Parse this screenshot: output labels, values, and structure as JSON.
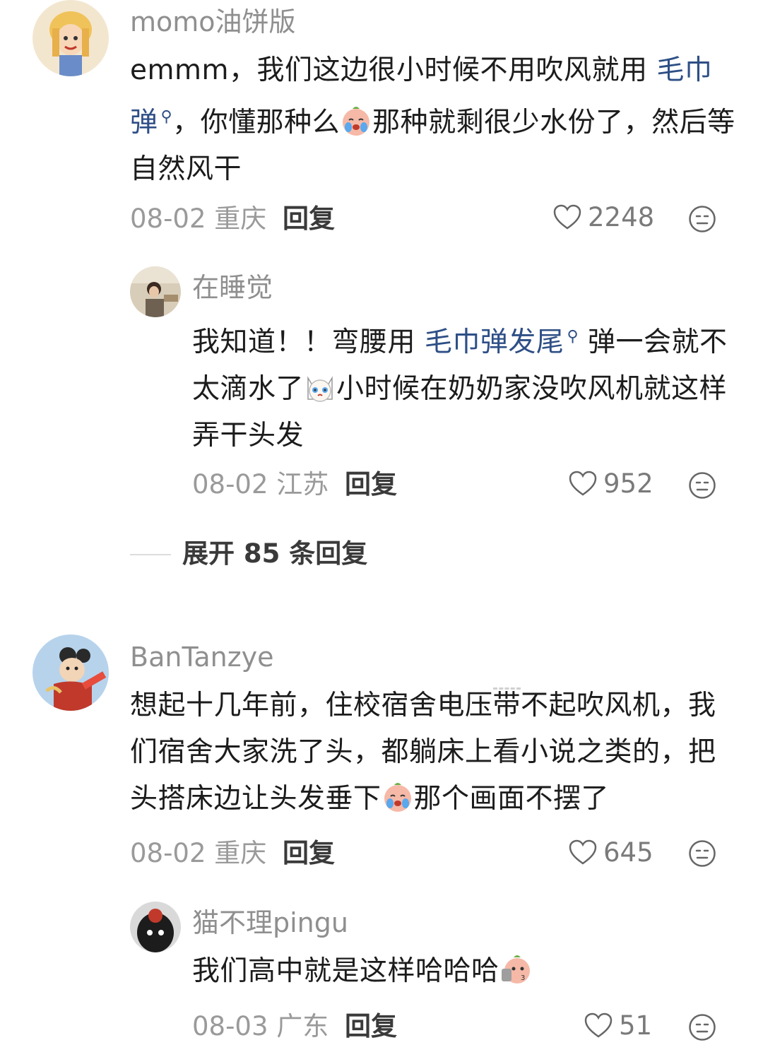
{
  "comments": [
    {
      "username": "momo油饼版",
      "text_1": "emmm，我们这边很小时候不用吹风就用",
      "link_1": "毛巾弹",
      "text_2": "，你懂那种么",
      "text_3": "那种就剩很少水份了，然后等自然风干",
      "date": "08-02",
      "location": "重庆",
      "reply_label": "回复",
      "likes": "2248"
    },
    {
      "username": "在睡觉",
      "text_1": "我知道！！弯腰用",
      "link_1": "毛巾弹发尾",
      "text_2": "弹一会就不太滴水了",
      "text_3": "小时候在奶奶家没吹风机就这样弄干头发",
      "date": "08-02",
      "location": "江苏",
      "reply_label": "回复",
      "likes": "952"
    },
    {
      "username": "BanTanzye",
      "text_1": "想起十几年前，住校宿舍电压",
      "text_mark": "带",
      "text_2": "不起吹风机，我们宿舍大家洗了头，都躺床上看小说之类的，把头搭床边让头发垂下",
      "text_3": "那个画面不摆了",
      "date": "08-02",
      "location": "重庆",
      "reply_label": "回复",
      "likes": "645"
    },
    {
      "username": "猫不理pingu",
      "text_1": "我们高中就是这样哈哈哈",
      "date": "08-03",
      "location": "广东",
      "reply_label": "回复",
      "likes": "51"
    }
  ],
  "expand_replies": "展开 85 条回复",
  "icons": {
    "search_link": "search-icon",
    "like": "heart-outline-icon",
    "dislike": "neutral-face-icon"
  }
}
